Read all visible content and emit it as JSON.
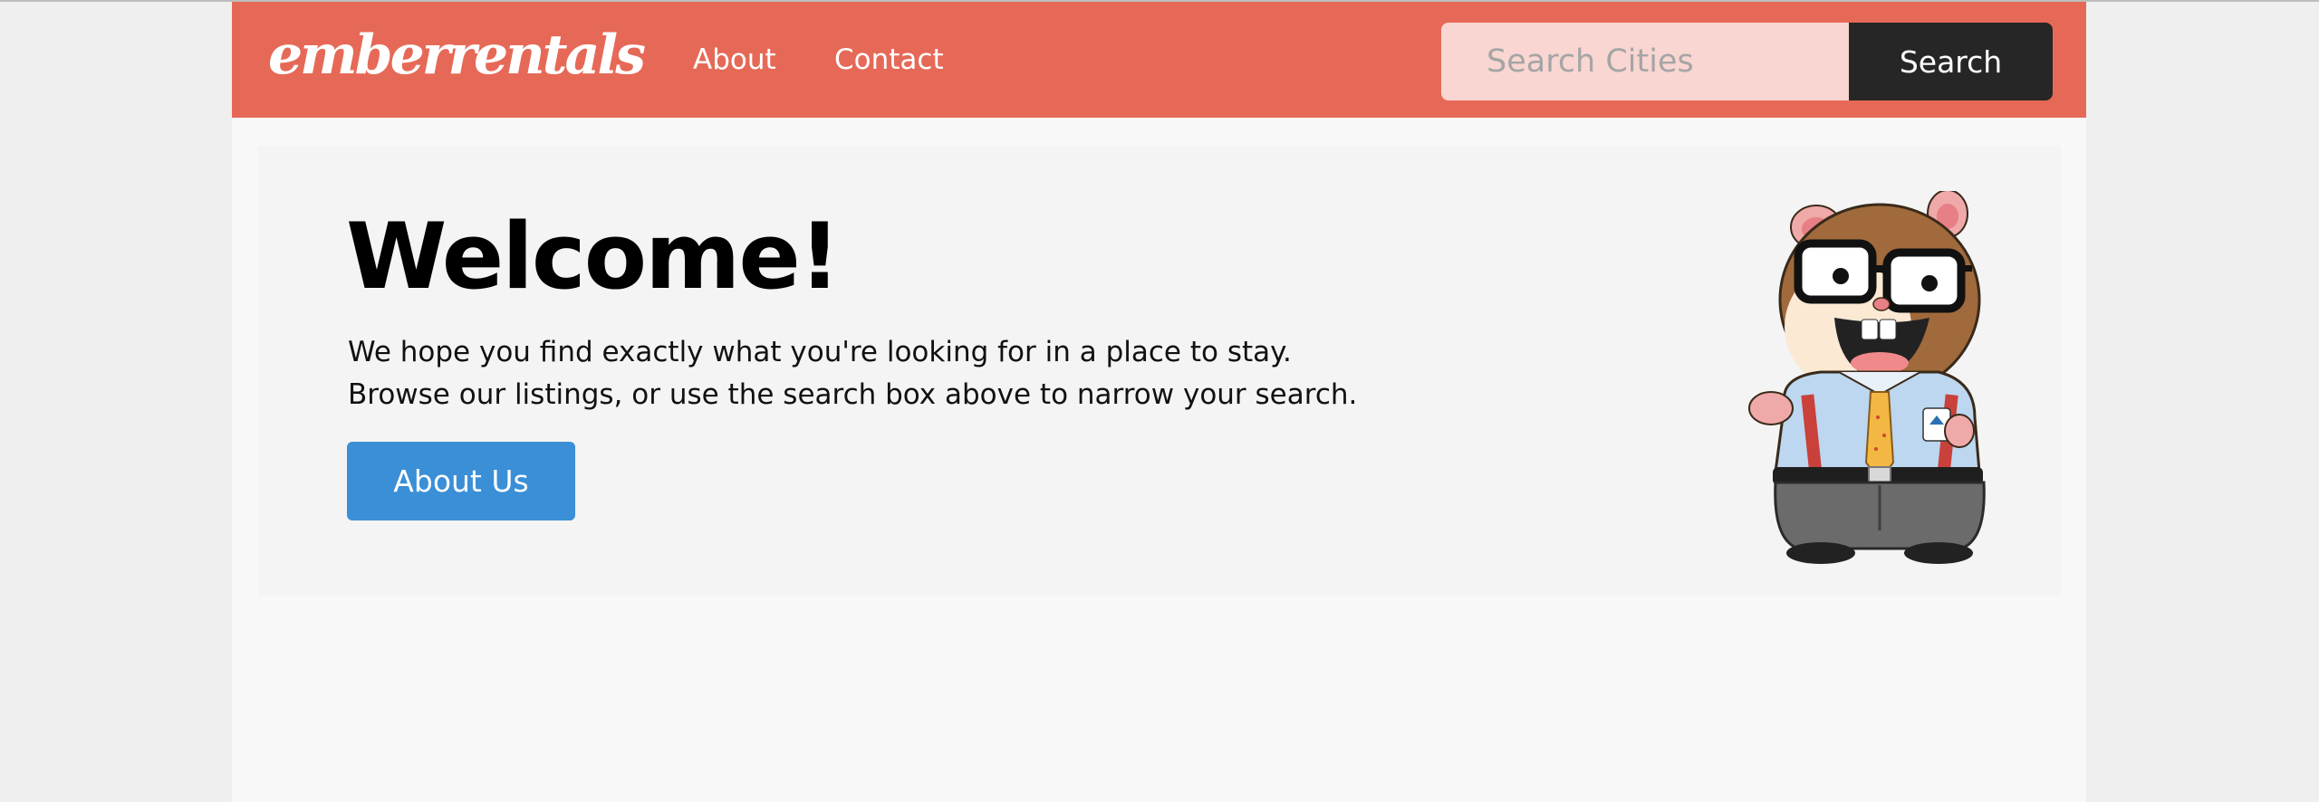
{
  "brand": {
    "logo_text": "emberrentals"
  },
  "nav": {
    "links": [
      {
        "label": "About"
      },
      {
        "label": "Contact"
      }
    ]
  },
  "search": {
    "placeholder": "Search Cities",
    "button_label": "Search"
  },
  "jumbotron": {
    "title": "Welcome!",
    "lines": [
      "We hope you find exactly what you're looking for in a place to stay.",
      "Browse our listings, or use the search box above to narrow your search."
    ],
    "button_label": "About Us",
    "image_icon": "tomster-mascot"
  },
  "colors": {
    "navbar": "#e66957",
    "search_input_bg": "#f9d6d2",
    "search_button_bg": "#262626",
    "primary_button": "#3a8fd7",
    "page_bg": "#f8f8f8",
    "jumbotron_bg": "#f4f4f4"
  }
}
